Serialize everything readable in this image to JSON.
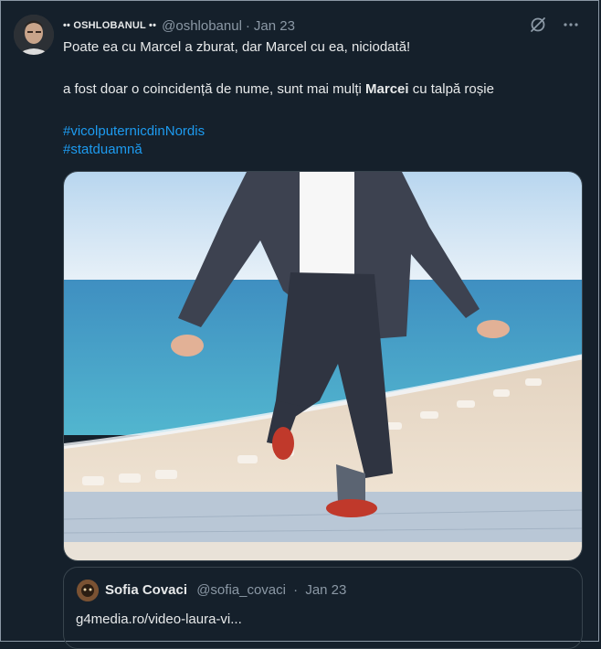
{
  "tweet": {
    "author": {
      "display_name": "•• OSHLOBANUL ••",
      "handle": "@oshlobanul",
      "separator": "·",
      "date": "Jan 23"
    },
    "lines": {
      "line1": "Poate ea cu Marcel a zburat, dar Marcel cu ea, niciodată!",
      "line2_before": "a fost doar o coincidență de nume, sunt mai mulți ",
      "line2_bold": "Marcei",
      "line2_after": " cu talpă roșie",
      "hashtag1": "#vicolputernicdinNordis",
      "hashtag2": "#statduamnă"
    },
    "icons": {
      "grok": "grok-icon",
      "more": "more-icon"
    }
  },
  "quote": {
    "display_name": "Sofia Covaci",
    "handle": "@sofia_covaci",
    "separator": "·",
    "date": "Jan 23",
    "text": "g4media.ro/video-laura-vi..."
  },
  "colors": {
    "background": "#15202b",
    "link": "#1d9bf0",
    "muted": "#8b98a5",
    "border": "#38444d"
  }
}
